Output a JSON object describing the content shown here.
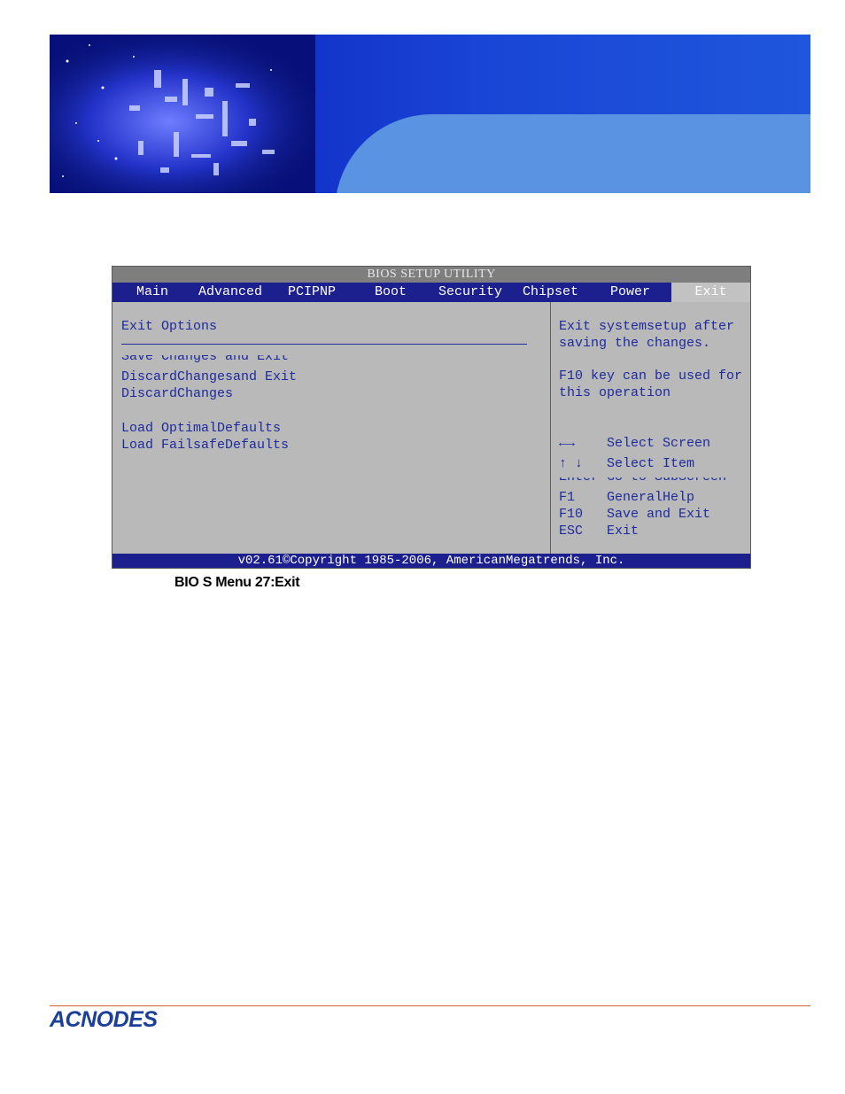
{
  "bios": {
    "title": "BIOS SETUP UTILITY",
    "tabs": [
      "Main",
      "Advanced",
      "PCIPNP",
      "Boot",
      "Security",
      "Chipset",
      "Power",
      "Exit"
    ],
    "active_tab": "Exit",
    "section_title": "Exit Options",
    "options": {
      "save_changes_and_exit": "Save Changes and Exit",
      "discard_changes_and_exit": "DiscardChangesand Exit",
      "discard_changes": "DiscardChanges",
      "load_optimal_defaults": "Load OptimalDefaults",
      "load_failsafe_defaults": "Load FailsafeDefaults"
    },
    "help": {
      "line1": "Exit systemsetup after",
      "line2": "saving the changes.",
      "line3": "F10 key can be used for",
      "line4": "this operation"
    },
    "keys": [
      {
        "key": "←→",
        "action": "Select Screen"
      },
      {
        "key": "↑ ↓",
        "action": "Select Item"
      },
      {
        "key": "Enter",
        "action": "Go to SubScreen"
      },
      {
        "key": "F1",
        "action": "GeneralHelp"
      },
      {
        "key": "F10",
        "action": "Save and Exit"
      },
      {
        "key": "ESC",
        "action": "Exit"
      }
    ],
    "copyright": "v02.61©Copyright 1985-2006, AmericanMegatrends, Inc."
  },
  "caption": "BIO S Menu 27:Exit",
  "brand": {
    "logo_text": "ACNODES",
    "color": "#1c3f9a",
    "rule_color": "#d0622a"
  },
  "icons": {
    "banner": "circuit-board-image",
    "select_screen": "arrows-left-right-icon"
  }
}
